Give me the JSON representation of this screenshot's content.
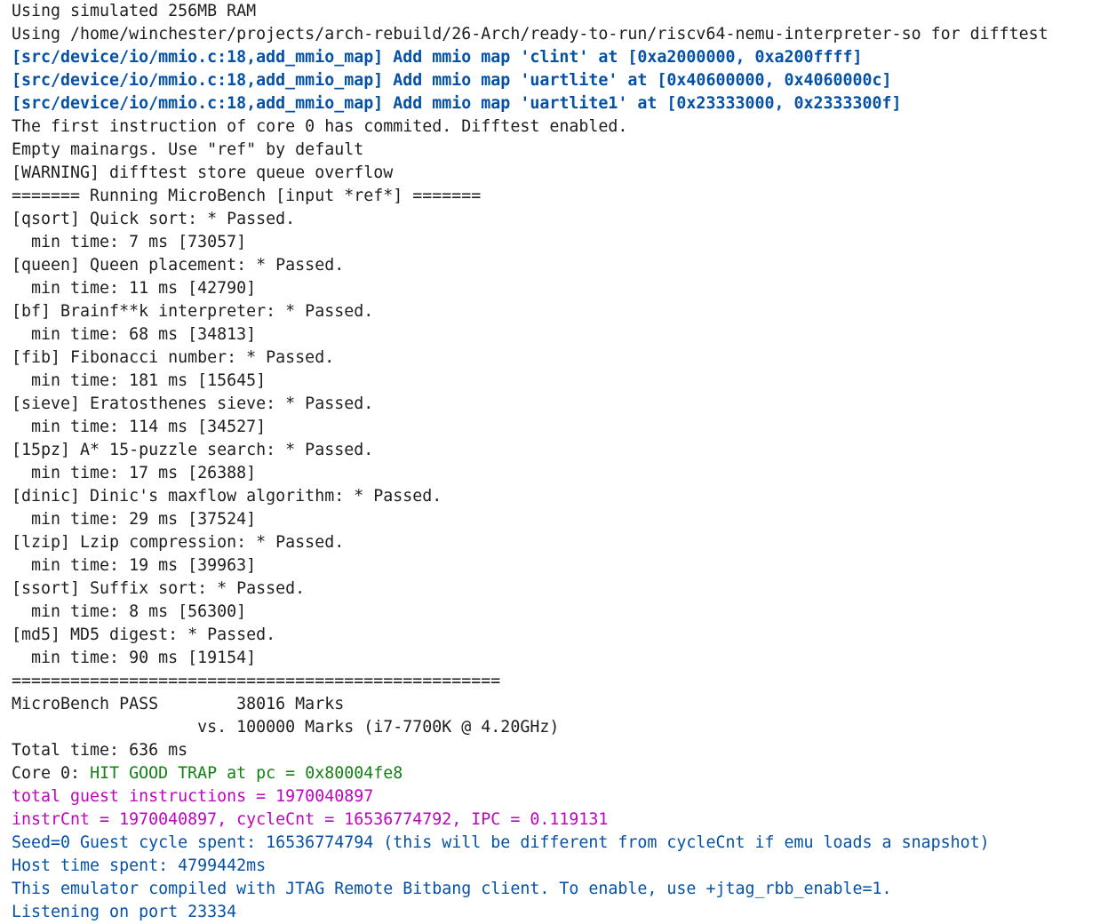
{
  "terminal": {
    "lines": [
      {
        "text": "Using simulated 256MB RAM",
        "color": "default"
      },
      {
        "text": "Using /home/winchester/projects/arch-rebuild/26-Arch/ready-to-run/riscv64-nemu-interpreter-so for difftest",
        "color": "default"
      },
      {
        "text": "[src/device/io/mmio.c:18,add_mmio_map] Add mmio map 'clint' at [0xa2000000, 0xa200ffff]",
        "color": "blue"
      },
      {
        "text": "[src/device/io/mmio.c:18,add_mmio_map] Add mmio map 'uartlite' at [0x40600000, 0x4060000c]",
        "color": "blue"
      },
      {
        "text": "[src/device/io/mmio.c:18,add_mmio_map] Add mmio map 'uartlite1' at [0x23333000, 0x2333300f]",
        "color": "blue"
      },
      {
        "text": "The first instruction of core 0 has commited. Difftest enabled.",
        "color": "default"
      },
      {
        "text": "Empty mainargs. Use \"ref\" by default",
        "color": "default"
      },
      {
        "text": "[WARNING] difftest store queue overflow",
        "color": "default"
      },
      {
        "text": "======= Running MicroBench [input *ref*] =======",
        "color": "default"
      },
      {
        "text": "[qsort] Quick sort: * Passed.",
        "color": "default"
      },
      {
        "text": "  min time: 7 ms [73057]",
        "color": "default"
      },
      {
        "text": "[queen] Queen placement: * Passed.",
        "color": "default"
      },
      {
        "text": "  min time: 11 ms [42790]",
        "color": "default"
      },
      {
        "text": "[bf] Brainf**k interpreter: * Passed.",
        "color": "default"
      },
      {
        "text": "  min time: 68 ms [34813]",
        "color": "default"
      },
      {
        "text": "[fib] Fibonacci number: * Passed.",
        "color": "default"
      },
      {
        "text": "  min time: 181 ms [15645]",
        "color": "default"
      },
      {
        "text": "[sieve] Eratosthenes sieve: * Passed.",
        "color": "default"
      },
      {
        "text": "  min time: 114 ms [34527]",
        "color": "default"
      },
      {
        "text": "[15pz] A* 15-puzzle search: * Passed.",
        "color": "default"
      },
      {
        "text": "  min time: 17 ms [26388]",
        "color": "default"
      },
      {
        "text": "[dinic] Dinic's maxflow algorithm: * Passed.",
        "color": "default"
      },
      {
        "text": "  min time: 29 ms [37524]",
        "color": "default"
      },
      {
        "text": "[lzip] Lzip compression: * Passed.",
        "color": "default"
      },
      {
        "text": "  min time: 19 ms [39963]",
        "color": "default"
      },
      {
        "text": "[ssort] Suffix sort: * Passed.",
        "color": "default"
      },
      {
        "text": "  min time: 8 ms [56300]",
        "color": "default"
      },
      {
        "text": "[md5] MD5 digest: * Passed.",
        "color": "default"
      },
      {
        "text": "  min time: 90 ms [19154]",
        "color": "default"
      },
      {
        "text": "==================================================",
        "color": "default"
      },
      {
        "text": "MicroBench PASS        38016 Marks",
        "color": "default"
      },
      {
        "text": "                   vs. 100000 Marks (i7-7700K @ 4.20GHz)",
        "color": "default"
      },
      {
        "text": "Total time: 636 ms",
        "color": "default"
      },
      {
        "segments": [
          {
            "text": "Core 0: ",
            "color": "default"
          },
          {
            "text": "HIT GOOD TRAP at pc = 0x80004fe8",
            "color": "green"
          }
        ]
      },
      {
        "text": "total guest instructions = 1970040897",
        "color": "magenta"
      },
      {
        "text": "instrCnt = 1970040897, cycleCnt = 16536774792, IPC = 0.119131",
        "color": "magenta"
      },
      {
        "text": "Seed=0 Guest cycle spent: 16536774794 (this will be different from cycleCnt if emu loads a snapshot)",
        "color": "cyan"
      },
      {
        "text": "Host time spent: 4799442ms",
        "color": "cyan"
      },
      {
        "text": "This emulator compiled with JTAG Remote Bitbang client. To enable, use +jtag_rbb_enable=1.",
        "color": "cyan"
      },
      {
        "text": "Listening on port 23334",
        "color": "cyan"
      }
    ]
  },
  "colors": {
    "default": "#1e1e1e",
    "blue": "#0451a5",
    "green": "#148014",
    "magenta": "#bc05bc",
    "cyan": "#0451a5"
  }
}
